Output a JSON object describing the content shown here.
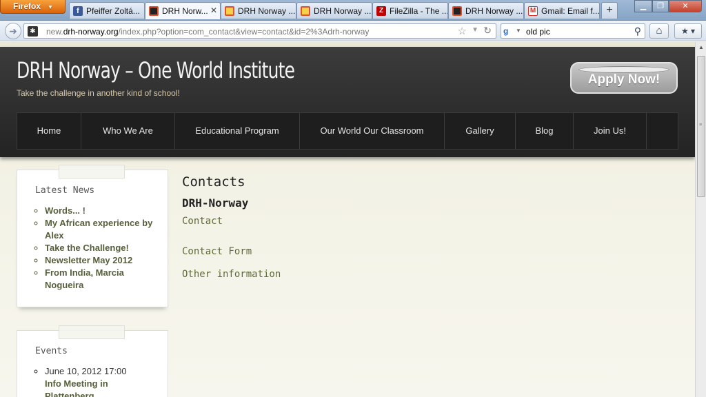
{
  "browser": {
    "menu_button": "Firefox",
    "tabs": [
      {
        "label": "Pfeiffer Zoltá...",
        "icon": "facebook-icon",
        "color": "#3b5998"
      },
      {
        "label": "DRH Norw...",
        "icon": "joomla-icon",
        "color": "#222222",
        "active": true
      },
      {
        "label": "DRH Norway ...",
        "icon": "joomla-icon",
        "color": "#e0502a"
      },
      {
        "label": "DRH Norway ...",
        "icon": "joomla-icon",
        "color": "#e0502a"
      },
      {
        "label": "FileZilla - The ...",
        "icon": "filezilla-icon",
        "color": "#bf0000"
      },
      {
        "label": "DRH Norway ...",
        "icon": "joomla-icon",
        "color": "#222222"
      },
      {
        "label": "Gmail: Email f...",
        "icon": "gmail-icon",
        "color": "#d93025"
      }
    ],
    "new_tab": "+",
    "url_prefix": "new.",
    "url_domain": "drh-norway.org",
    "url_path": "/index.php?option=com_contact&view=contact&id=2%3Adrh-norway",
    "search_value": "old pic"
  },
  "site": {
    "title": "DRH Norway – One World Institute",
    "tagline": "Take the challenge in another kind of school!",
    "apply_label": "Apply Now!",
    "nav": [
      "Home",
      "Who We Are",
      "Educational Program",
      "Our World Our Classroom",
      "Gallery",
      "Blog",
      "Join Us!"
    ]
  },
  "sidebar": {
    "latest_news": {
      "title": "Latest News",
      "items": [
        "Words... !",
        "My African experience by Alex",
        "Take the Challenge!",
        "Newsletter May 2012",
        "From India, Marcia Nogueira"
      ]
    },
    "events": {
      "title": "Events",
      "items": [
        "June 10, 2012 17:00",
        "Info Meeting in Plattenberg..."
      ]
    }
  },
  "content": {
    "heading": "Contacts",
    "name": "DRH-Norway",
    "contact": "Contact",
    "contact_form": "Contact Form",
    "other_information": "Other information"
  },
  "colors": {
    "header_bg": "#2a2a2a",
    "link_olive": "#5e6a36",
    "page_bg": "#f3f2e6"
  }
}
